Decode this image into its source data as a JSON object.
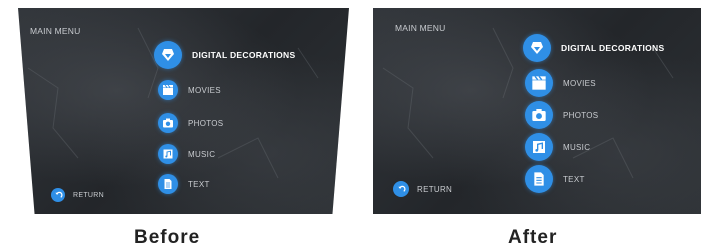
{
  "before": {
    "menu_title": "MAIN MENU",
    "items": [
      {
        "label": "DIGITAL DECORATIONS",
        "icon": "gem-icon"
      },
      {
        "label": "MOVIES",
        "icon": "clapperboard-icon"
      },
      {
        "label": "PHOTOS",
        "icon": "camera-icon"
      },
      {
        "label": "MUSIC",
        "icon": "music-note-icon"
      },
      {
        "label": "TEXT",
        "icon": "document-icon"
      }
    ],
    "return_label": "RETURN"
  },
  "after": {
    "menu_title": "MAIN MENU",
    "items": [
      {
        "label": "DIGITAL DECORATIONS",
        "icon": "gem-icon"
      },
      {
        "label": "MOVIES",
        "icon": "clapperboard-icon"
      },
      {
        "label": "PHOTOS",
        "icon": "camera-icon"
      },
      {
        "label": "MUSIC",
        "icon": "music-note-icon"
      },
      {
        "label": "TEXT",
        "icon": "document-icon"
      }
    ],
    "return_label": "RETURN"
  },
  "captions": {
    "before": "Before",
    "after": "After"
  },
  "colors": {
    "accent": "#2f8fe6",
    "screen_bg": "#2a2d31",
    "text": "#c9ccd0"
  }
}
